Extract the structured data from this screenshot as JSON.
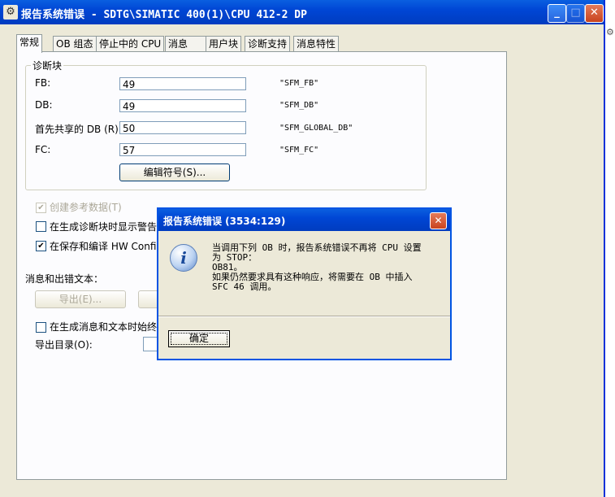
{
  "window": {
    "title": "报告系统错误 - SDTG\\SIMATIC 400(1)\\CPU 412-2 DP",
    "min": "_",
    "max": "□",
    "close": "✕"
  },
  "tabs": [
    "常规",
    "OB 组态",
    "停止中的 CPU",
    "消息",
    "用户块",
    "诊断支持",
    "消息特性"
  ],
  "diag_block": {
    "title": "诊断块",
    "rows": [
      {
        "label": "FB:",
        "value": "49",
        "symbol": "\"SFM_FB\""
      },
      {
        "label": "DB:",
        "value": "49",
        "symbol": "\"SFM_DB\""
      },
      {
        "label": "首先共享的 DB (R)",
        "value": "50",
        "symbol": "\"SFM_GLOBAL_DB\""
      },
      {
        "label": "FC:",
        "value": "57",
        "symbol": "\"SFM_FC\""
      }
    ],
    "edit_button": "编辑符号(S)..."
  },
  "options": {
    "create_ref": "创建参考数据(T)",
    "show_warning": "在生成诊断块时显示警告",
    "save_compile": "在保存和编译 HW Config"
  },
  "messages": {
    "title": "消息和出错文本：",
    "export_button": "导出(E)...",
    "always_label": "在生成消息和文本时始终",
    "export_dir": "导出目录(O):"
  },
  "dialog": {
    "title": "报告系统错误 (3534:129)",
    "close": "✕",
    "message": "当调用下列 OB 时，报告系统错误不再将 CPU 设置\n为 STOP：\nOB81。\n如果仍然要求具有这种响应，将需要在 OB 中插入\nSFC 46 调用。",
    "ok": "确定"
  },
  "colors": {
    "titlebar": "#0046d5",
    "face": "#ece9d8"
  }
}
